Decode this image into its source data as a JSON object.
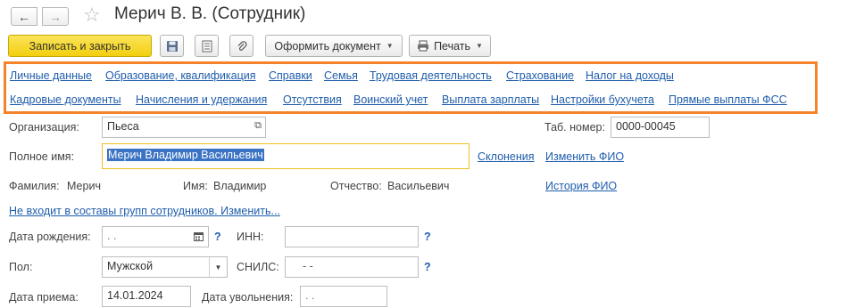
{
  "nav": {
    "back_icon": "arrow-left-icon",
    "forward_icon": "arrow-right-icon",
    "favorite_icon": "star-icon"
  },
  "window": {
    "title": "Мерич В. В. (Сотрудник)"
  },
  "toolbar": {
    "save_close": "Записать и закрыть",
    "save_icon": "floppy-disk-icon",
    "list_icon": "document-list-icon",
    "attach_icon": "paperclip-icon",
    "create_doc": "Оформить документ",
    "print": "Печать"
  },
  "links_row1": [
    "Личные данные",
    "Образование, квалификация",
    "Справки",
    "Семья",
    "Трудовая деятельность",
    "Страхование",
    "Налог на доходы"
  ],
  "links_row2": [
    "Кадровые документы",
    "Начисления и удержания",
    "Отсутствия",
    "Воинский учет",
    "Выплата зарплаты",
    "Настройки бухучета",
    "Прямые выплаты ФСС"
  ],
  "form": {
    "org_label": "Организация:",
    "org_value": "Пьеса",
    "tab_label": "Таб. номер:",
    "tab_value": "0000-00045",
    "fullname_label": "Полное имя:",
    "fullname_value": "Мерич Владимир Васильевич",
    "declensions": "Склонения",
    "change_fio": "Изменить ФИО",
    "surname_label": "Фамилия:",
    "surname_value": "Мерич",
    "name_label": "Имя:",
    "name_value": "Владимир",
    "patronymic_label": "Отчество:",
    "patronymic_value": "Васильевич",
    "fio_history": "История ФИО",
    "groups_link": "Не входит в составы групп сотрудников. Изменить...",
    "birth_label": "Дата рождения:",
    "birth_value": " .  .",
    "inn_label": "ИНН:",
    "inn_value": "",
    "help_mark": "?",
    "sex_label": "Пол:",
    "sex_value": "Мужской",
    "snils_label": "СНИЛС:",
    "snils_value": "-    -",
    "hire_label": "Дата приема:",
    "hire_value": "14.01.2024",
    "fire_label": "Дата увольнения:",
    "fire_value": " .  ."
  }
}
